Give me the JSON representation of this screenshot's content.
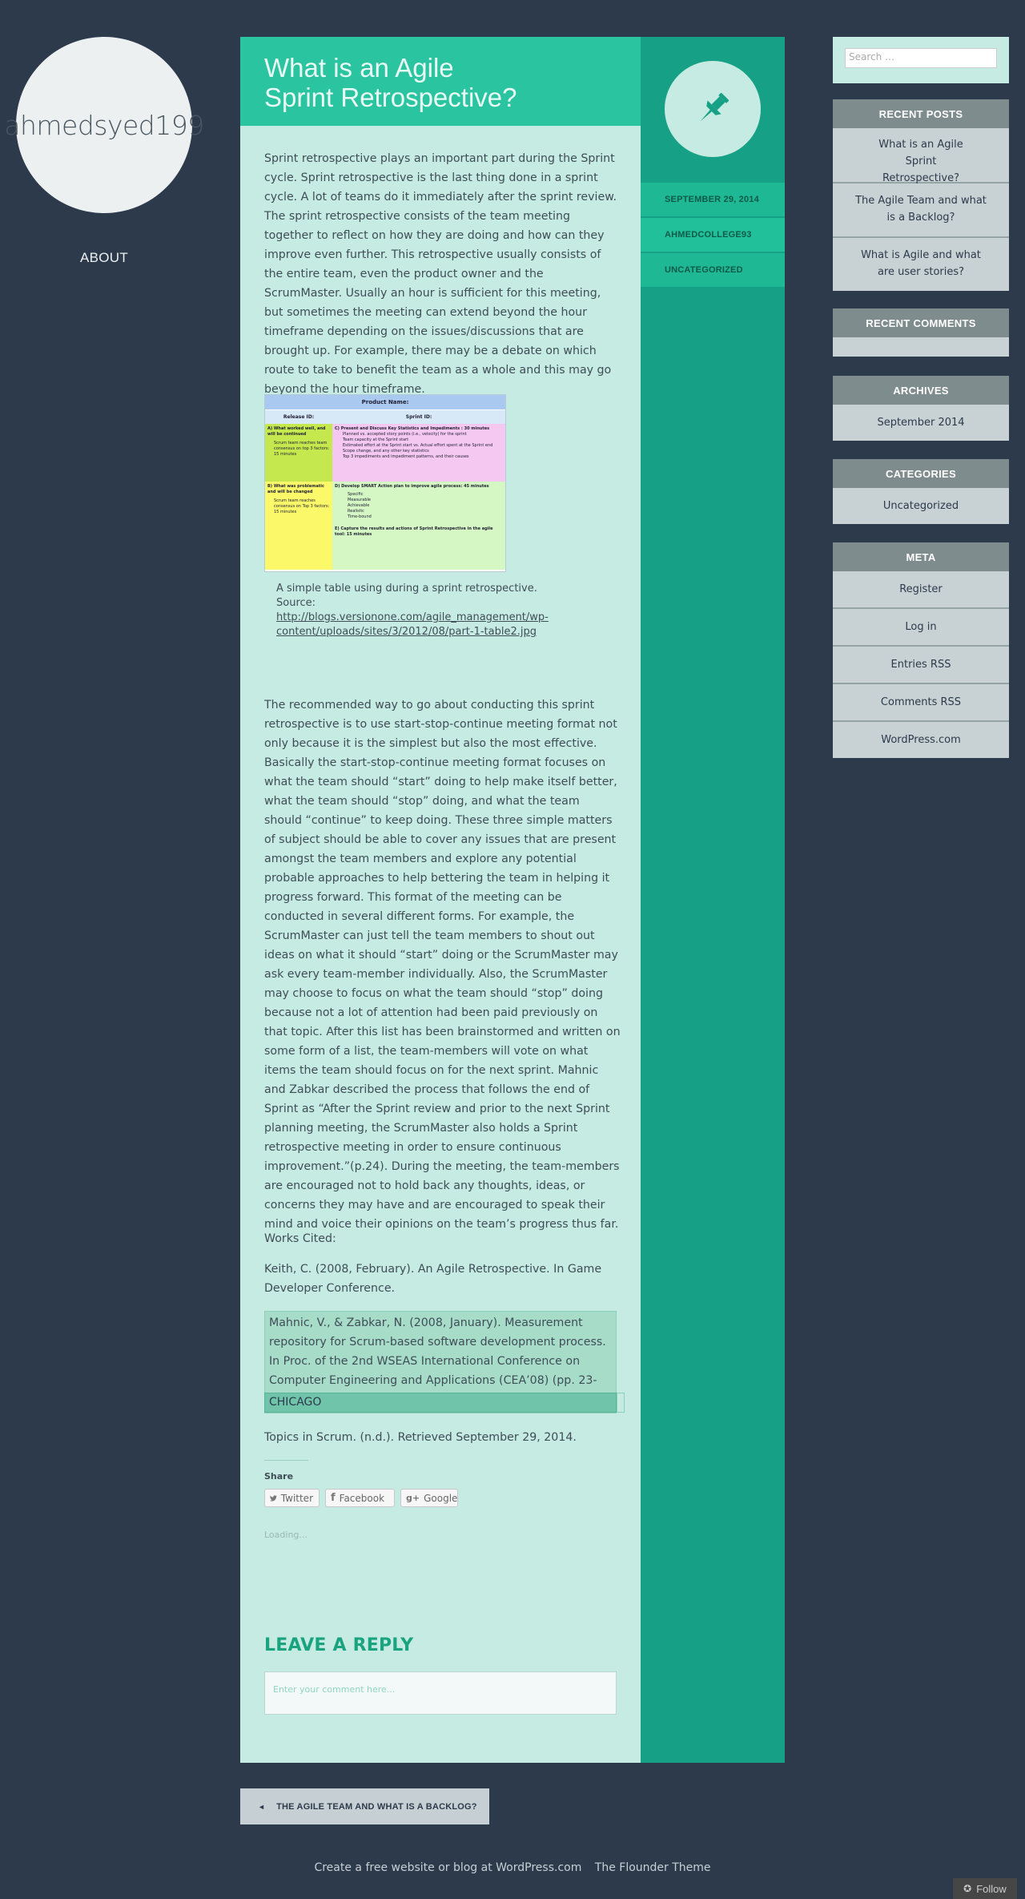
{
  "site": {
    "title": "ahmedsyed199",
    "nav_about": "ABOUT"
  },
  "post": {
    "title_line1": "What is an Agile",
    "title_line2": "Sprint Retrospective?",
    "paragraph1": "Sprint retrospective plays an important part during the Sprint cycle.  Sprint  retrospective is the last thing done in a sprint cycle.  A lot of teams do it immediately after the sprint review. The sprint retrospective consists of the team meeting together to reflect on how they are doing and how can they improve even further. This retrospective usually consists of the entire team, even the product owner and the ScrumMaster. Usually an hour is sufficient for this meeting, but sometimes the meeting can extend beyond the hour timeframe depending on the issues/discussions that are brought up. For example, there may be a debate on which route to take to benefit the team as a whole and this may go beyond the hour timeframe.",
    "table_image": {
      "product_name": "Product Name:",
      "release": "Release ID:",
      "sprint": "Sprint ID:",
      "a_label": "A) What worked well, and will be continued",
      "a_item": "Scrum team reaches team consensus on top 3 factors: 15 minutes",
      "b_label": "B) What was problematic and will be changed",
      "b_item": "Scrum team reaches consensus on Top 3 factors: 15 minutes",
      "c_label": "C) Present and Discuss Key Statistics and Impediments : 30 minutes",
      "c_items": [
        "Planned vs. accepted story points (i.e., velocity) for the sprint",
        "Team capacity at the Sprint start",
        "Estimated effort at the Sprint start vs. Actual effort spent at the Sprint end",
        "Scope change, and any other key statistics",
        "Top 3 impediments and impediment patterns, and their causes"
      ],
      "d_label": "D) Develop  SMART Action plan  to improve agile process: 45 minutes",
      "d_items": [
        "Specific",
        "Measurable",
        "Achievable",
        "Realistic",
        "Time-bound"
      ],
      "e_label": "E) Capture  the results and actions of Sprint Retrospective in the agile tool: 15 minutes"
    },
    "caption_text": "A simple table using during a sprint retrospective.",
    "caption_source": "Source:",
    "caption_link": "http://blogs.versionone.com/agile_management/wp-content/uploads/sites/3/2012/08/part-1-table2.jpg",
    "paragraph2": "The recommended way to go about conducting this sprint retrospective is to use start-stop-continue meeting  format not only because it is the simplest but also the most effective. Basically the start-stop-continue meeting format focuses on what the team should “start” doing to help make itself better, what the team should “stop” doing, and what the team should “continue” to keep doing.  These three simple matters of subject should be able to cover any issues that are present amongst the team members and explore any potential probable approaches to help bettering the team in helping it progress forward. This format of the meeting can be conducted in several different forms. For example, the ScrumMaster can just tell the team members to shout out ideas on what it should “start” doing or the ScrumMaster may ask every team-member individually. Also, the ScrumMaster may choose to focus on what the team should “stop” doing because not a lot of attention had been paid previously on that topic. After this list has been brainstormed and written on some form of a list, the team-members will vote on what items the team should focus on for the next sprint. Mahnic and Zabkar described the process that follows the end of Sprint as “After the Sprint review and prior to the next Sprint planning meeting, the ScrumMaster also holds a Sprint retrospective meeting in order to ensure continuous improvement.”(p.24). During the meeting, the team-members are encouraged not to hold back any thoughts, ideas, or concerns they may have and are encouraged to speak their mind and voice their opinions on the team’s progress thus far.",
    "works_cited": "Works Cited:",
    "cite1": "Keith, C. (2008, February). An Agile Retrospective. In Game Developer Conference.",
    "cite2": "Mahnic, V., & Zabkar, N. (2008, January). Measurement repository for Scrum-based software development process. In Proc. of the 2nd WSEAS International Conference on Computer Engineering and Applications (CEA’08) (pp. 23-28).",
    "cite_style": "CHICAGO",
    "cite3": "Topics in Scrum. (n.d.). Retrieved September 29, 2014.",
    "share_title": "Share this:",
    "share_buttons": [
      "Twitter",
      "Facebook",
      "Google"
    ],
    "loading": "Loading...",
    "reply_title": "LEAVE A REPLY",
    "reply_placeholder": "Enter your comment here..."
  },
  "meta": {
    "date": "SEPTEMBER 29, 2014",
    "author": "AHMEDCOLLEGE93",
    "category": "UNCATEGORIZED"
  },
  "sidebar": {
    "search_placeholder": "Search …",
    "recent_posts_title": "RECENT POSTS",
    "recent_posts": [
      "What is an Agile Sprint Retrospective?",
      "The Agile Team and what is a Backlog?",
      "What is Agile and what are user stories?"
    ],
    "recent_comments_title": "RECENT COMMENTS",
    "archives_title": "ARCHIVES",
    "archives": [
      "September 2014"
    ],
    "categories_title": "CATEGORIES",
    "categories": [
      "Uncategorized"
    ],
    "meta_title": "META",
    "meta_links": [
      "Register",
      "Log in",
      "Entries RSS",
      "Comments RSS",
      "WordPress.com"
    ]
  },
  "footer": {
    "prev_post": "THE AGILE TEAM AND WHAT IS A BACKLOG?",
    "prev_arrow": "◄",
    "credit": "Create a free website or blog at WordPress.com",
    "theme": "The Flounder Theme",
    "follow": "Follow"
  },
  "colors": {
    "background": "#2d3a4b",
    "post_header": "#2ac4a0",
    "post_body": "#c6ebe2",
    "meta_column": "#16a085",
    "widget_head": "#7f8c8d",
    "accent_heading": "#1aa37f"
  }
}
